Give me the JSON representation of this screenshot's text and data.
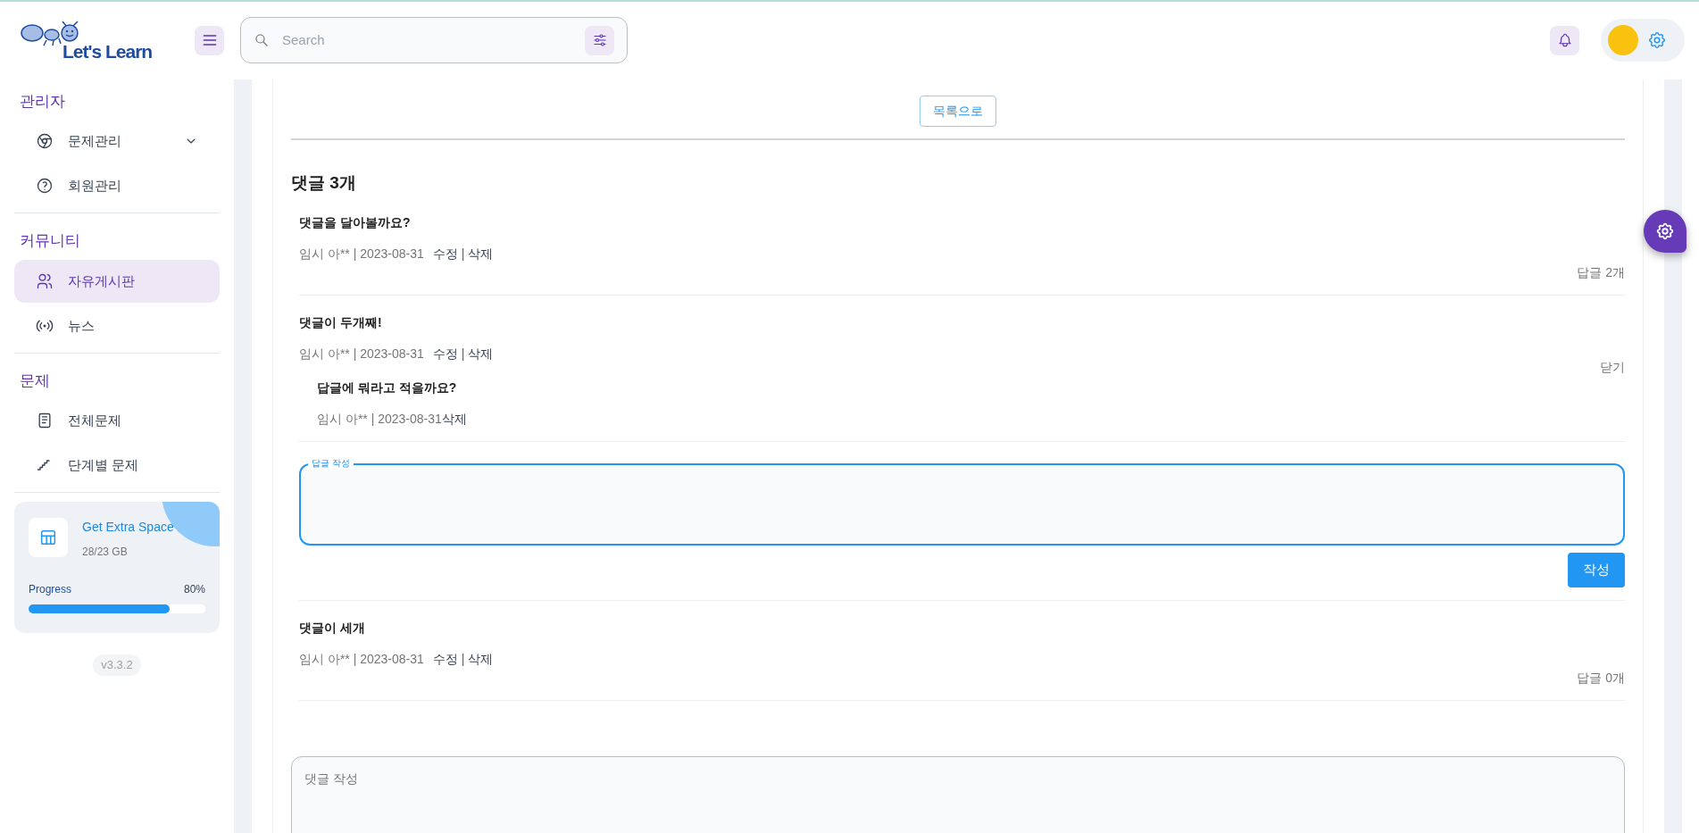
{
  "logo": {
    "text": "Let's Learn"
  },
  "search": {
    "placeholder": "Search"
  },
  "sidebar": {
    "sections": [
      {
        "title": "관리자",
        "items": [
          {
            "label": "문제관리",
            "kind": "group",
            "expanded": false,
            "selected": false
          },
          {
            "label": "회원관리",
            "kind": "link",
            "selected": false
          }
        ]
      },
      {
        "title": "커뮤니티",
        "items": [
          {
            "label": "자유게시판",
            "kind": "link",
            "selected": true
          },
          {
            "label": "뉴스",
            "kind": "link",
            "selected": false
          }
        ]
      },
      {
        "title": "문제",
        "items": [
          {
            "label": "전체문제",
            "kind": "link",
            "selected": false
          },
          {
            "label": "단계별 문제",
            "kind": "link",
            "selected": false
          }
        ]
      }
    ]
  },
  "storage_card": {
    "title": "Get Extra Space",
    "subtitle": "28/23 GB",
    "progress_label": "Progress",
    "progress_value": "80%",
    "level": 0.8
  },
  "version": "v3.3.2",
  "back_button": "목록으로",
  "comments_heading": "댓글 3개",
  "comments": [
    {
      "text": "댓글을 달아볼까요?",
      "meta": "임시 아** | 2023-08-31",
      "actions": [
        {
          "kind": "link",
          "label": "수정"
        },
        {
          "kind": "separator",
          "label": "|"
        },
        {
          "kind": "link",
          "label": "삭제"
        }
      ],
      "reply_toggle": "답글 2개",
      "expanded": false
    },
    {
      "text": "댓글이 두개째!",
      "meta": "임시 아** | 2023-08-31",
      "actions": [
        {
          "kind": "link",
          "label": "수정"
        },
        {
          "kind": "separator",
          "label": "|"
        },
        {
          "kind": "link",
          "label": "삭제"
        }
      ],
      "reply_toggle": "닫기",
      "expanded": true,
      "replies": [
        {
          "text": "답글에 뭐라고 적을까요?",
          "meta": "임시 아** | 2023-08-31",
          "actions": [
            {
              "kind": "link",
              "label": "삭제"
            }
          ]
        }
      ],
      "reply_editor": {
        "label": "답글 작성",
        "submit": "작성"
      }
    },
    {
      "text": "댓글이 세개",
      "meta": "임시 아** | 2023-08-31",
      "actions": [
        {
          "kind": "link",
          "label": "수정"
        },
        {
          "kind": "separator",
          "label": "|"
        },
        {
          "kind": "link",
          "label": "삭제"
        }
      ],
      "reply_toggle": "답글 0개",
      "expanded": false
    }
  ],
  "new_comment": {
    "placeholder": "댓글 작성"
  }
}
